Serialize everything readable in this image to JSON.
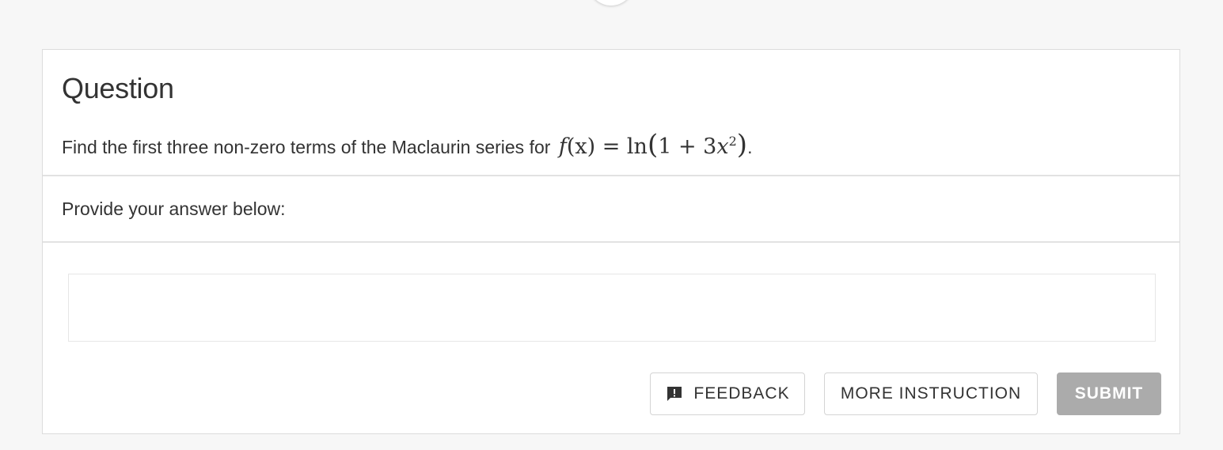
{
  "question": {
    "title": "Question",
    "text": "Find the first three non-zero terms of the Maclaurin series for",
    "formula": {
      "lhs_f": "f",
      "lhs_arg": "(x)",
      "equals": "=",
      "func": "ln",
      "open": "(",
      "inner_coeff": "1 + 3",
      "inner_var": "x",
      "exponent": "2",
      "close": ")",
      "trailing": "."
    }
  },
  "answer": {
    "prompt": "Provide your answer below:",
    "value": ""
  },
  "actions": {
    "feedback_label": "FEEDBACK",
    "more_instruction_label": "MORE INSTRUCTION",
    "submit_label": "SUBMIT"
  },
  "icons": {
    "feedback": "feedback-icon"
  },
  "colors": {
    "submit_bg": "#ababab",
    "page_bg": "#f7f7f7"
  }
}
